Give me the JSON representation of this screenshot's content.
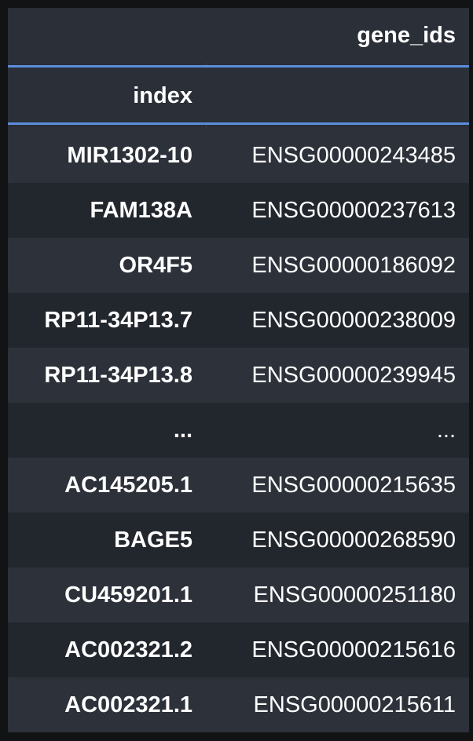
{
  "table": {
    "columns": {
      "index_header": "index",
      "gene_ids_header": "gene_ids"
    },
    "rows": [
      {
        "index": "MIR1302-10",
        "gene_ids": "ENSG00000243485"
      },
      {
        "index": "FAM138A",
        "gene_ids": "ENSG00000237613"
      },
      {
        "index": "OR4F5",
        "gene_ids": "ENSG00000186092"
      },
      {
        "index": "RP11-34P13.7",
        "gene_ids": "ENSG00000238009"
      },
      {
        "index": "RP11-34P13.8",
        "gene_ids": "ENSG00000239945"
      },
      {
        "index": "...",
        "gene_ids": "..."
      },
      {
        "index": "AC145205.1",
        "gene_ids": "ENSG00000215635"
      },
      {
        "index": "BAGE5",
        "gene_ids": "ENSG00000268590"
      },
      {
        "index": "CU459201.1",
        "gene_ids": "ENSG00000251180"
      },
      {
        "index": "AC002321.2",
        "gene_ids": "ENSG00000215616"
      },
      {
        "index": "AC002321.1",
        "gene_ids": "ENSG00000215611"
      }
    ]
  },
  "colors": {
    "header_bg": "#2a2f38",
    "row_even_bg": "#2c313a",
    "row_odd_bg": "#22262d",
    "accent_rule": "#5b8edb",
    "text": "#ffffff"
  }
}
